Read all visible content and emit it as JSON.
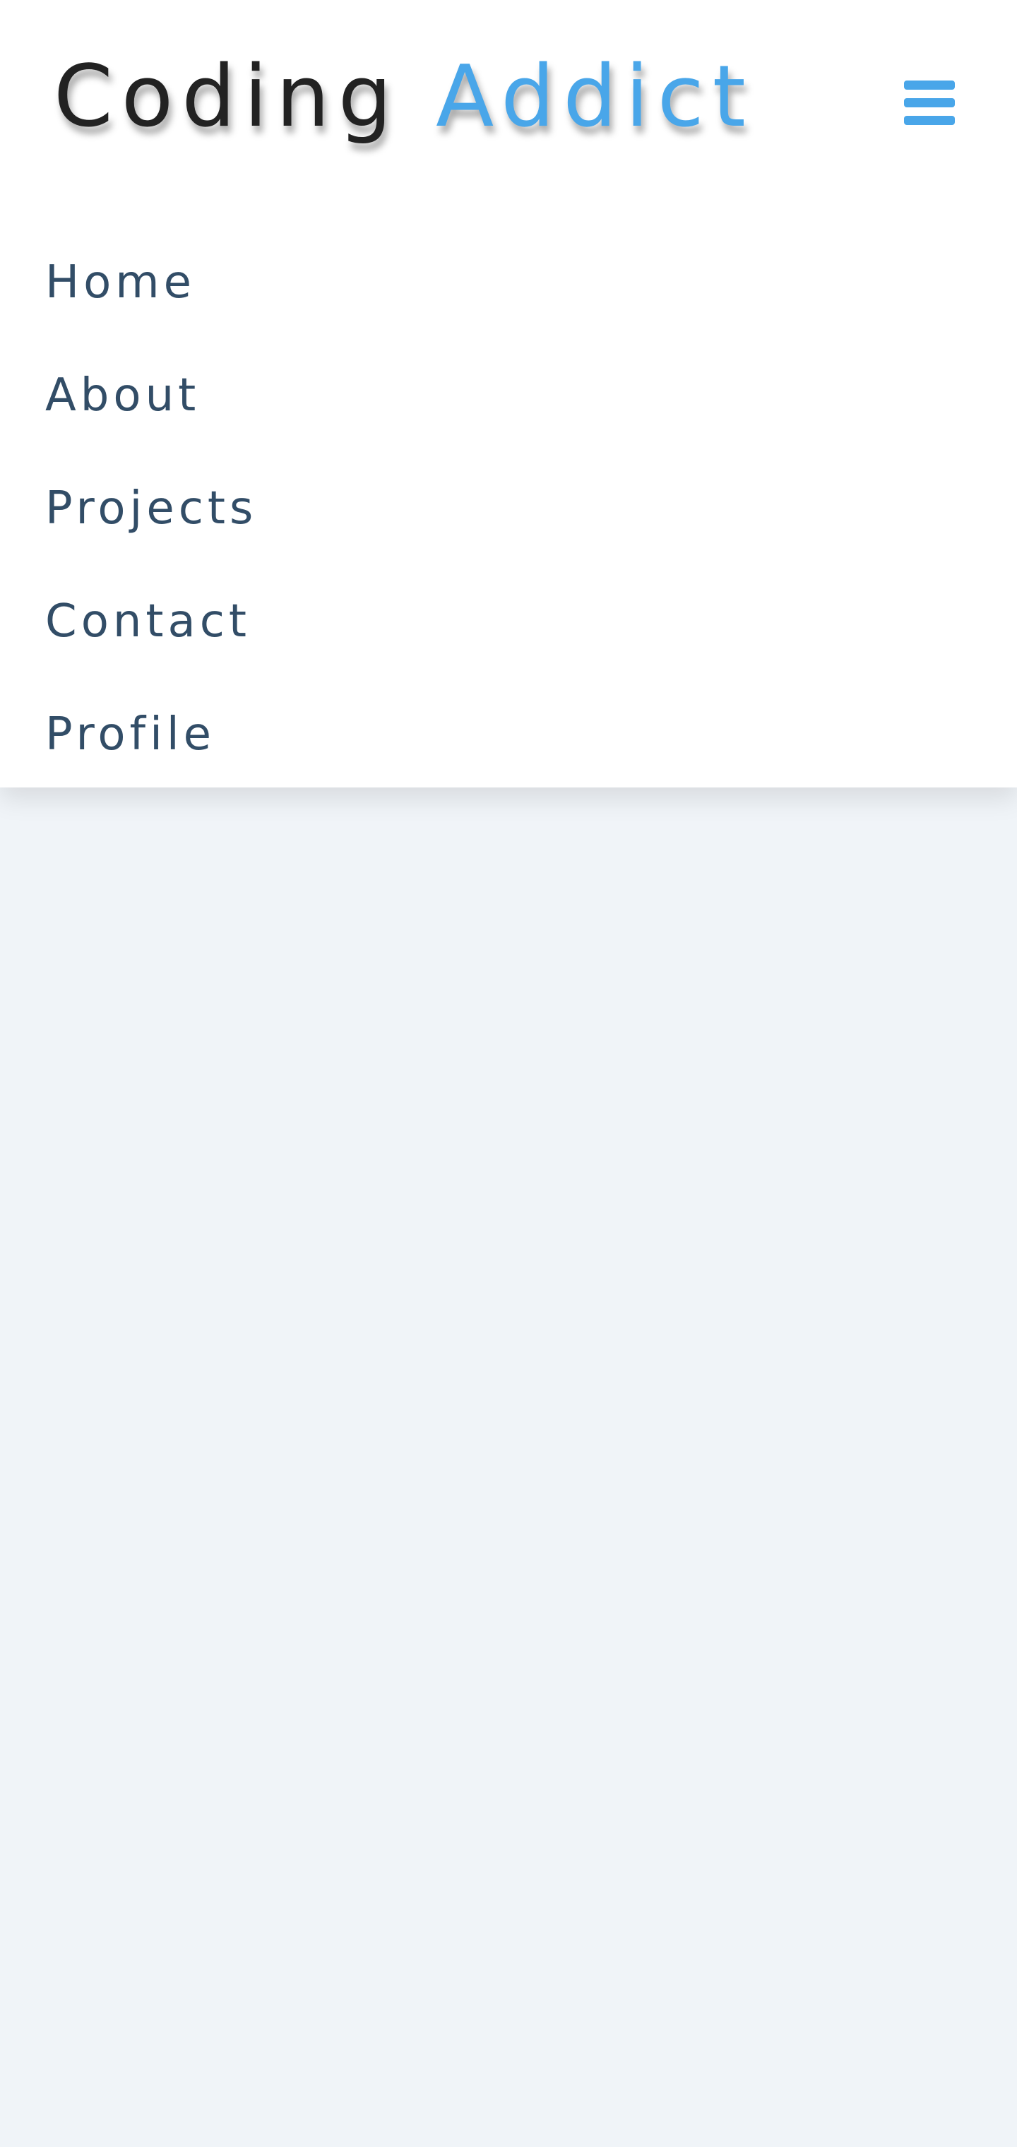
{
  "header": {
    "logo_primary": "Coding",
    "logo_accent": "Addict",
    "menu_icon": "hamburger-menu-icon"
  },
  "nav": {
    "items": [
      {
        "label": "Home"
      },
      {
        "label": "About"
      },
      {
        "label": "Projects"
      },
      {
        "label": "Contact"
      },
      {
        "label": "Profile"
      }
    ]
  },
  "colors": {
    "accent": "#49a6e9",
    "logo_text": "#222222",
    "link_text": "#324d67",
    "page_background": "#f0f4f8",
    "nav_background": "#ffffff"
  }
}
